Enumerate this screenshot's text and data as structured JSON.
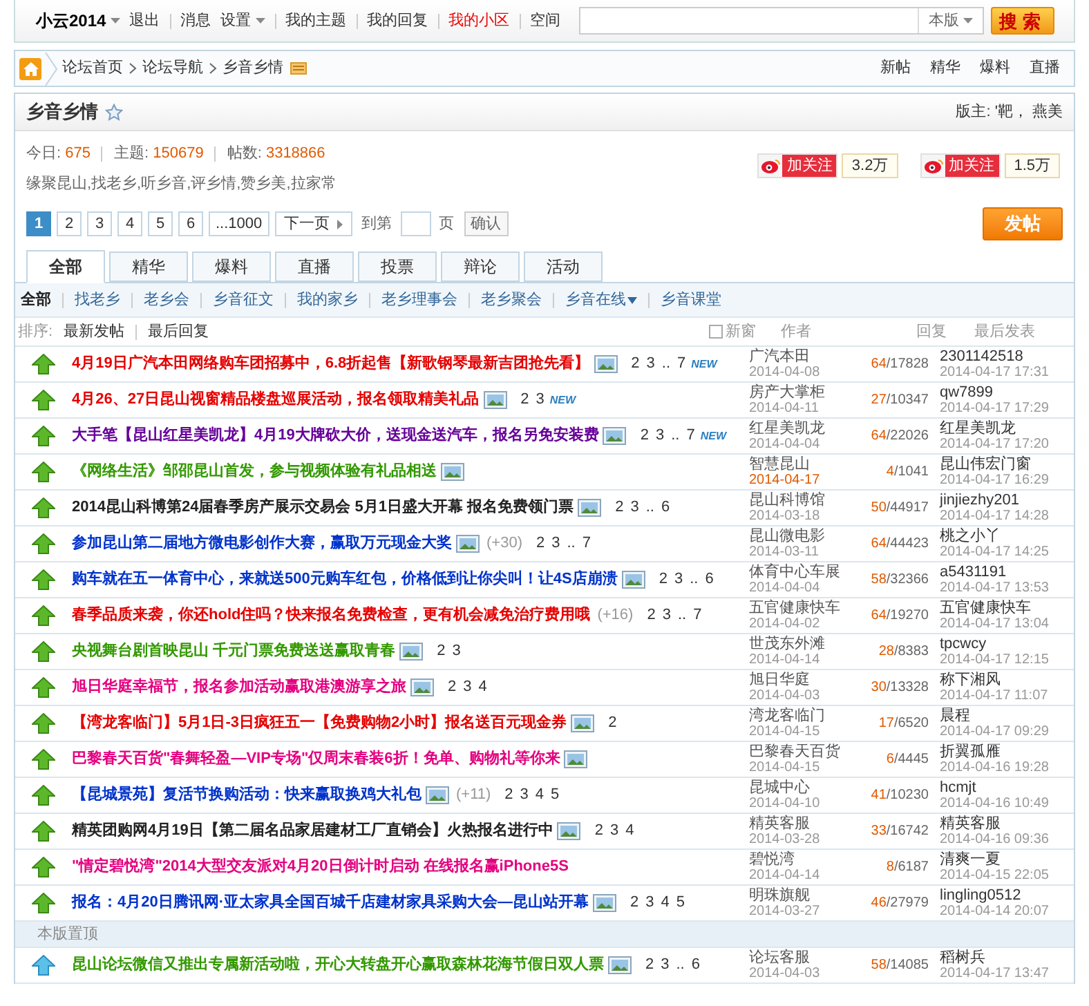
{
  "top_bar": {
    "user": "小云2014",
    "links": [
      {
        "label": "退出",
        "kind": "plain"
      },
      {
        "label": "消息",
        "kind": "plain"
      },
      {
        "label": "设置",
        "kind": "dropdown"
      },
      {
        "label": "我的主题",
        "kind": "plain"
      },
      {
        "label": "我的回复",
        "kind": "plain"
      },
      {
        "label": "我的小区",
        "kind": "highlight"
      },
      {
        "label": "空间",
        "kind": "plain"
      }
    ],
    "search": {
      "scope": "本版",
      "button": "搜索"
    }
  },
  "breadcrumb": {
    "items": [
      "论坛首页",
      "论坛导航",
      "乡音乡情"
    ],
    "quick_links": [
      "新帖",
      "精华",
      "爆料",
      "直播"
    ]
  },
  "forum": {
    "title": "乡音乡情",
    "moderators": "版主: '靶， 燕美",
    "stats": [
      {
        "label": "今日:",
        "value": "675"
      },
      {
        "label": "主题:",
        "value": "150679"
      },
      {
        "label": "帖数:",
        "value": "3318866"
      }
    ],
    "description": "缘聚昆山,找老乡,听乡音,评乡情,赞乡美,拉家常",
    "follows": [
      {
        "label": "加关注",
        "count": "3.2万"
      },
      {
        "label": "加关注",
        "count": "1.5万"
      }
    ],
    "pagination": {
      "pages": [
        {
          "label": "1",
          "selected": true
        },
        {
          "label": "2",
          "selected": false
        },
        {
          "label": "3",
          "selected": false
        },
        {
          "label": "4",
          "selected": false
        },
        {
          "label": "5",
          "selected": false
        },
        {
          "label": "6",
          "selected": false
        },
        {
          "label": "...1000",
          "selected": false
        }
      ],
      "next": "下一页",
      "goto_prefix": "到第",
      "goto_suffix": "页",
      "confirm": "确认"
    },
    "post_button": "发帖"
  },
  "tabs": [
    {
      "label": "全部",
      "selected": true
    },
    {
      "label": "精华",
      "selected": false
    },
    {
      "label": "爆料",
      "selected": false
    },
    {
      "label": "直播",
      "selected": false
    },
    {
      "label": "投票",
      "selected": false
    },
    {
      "label": "辩论",
      "selected": false
    },
    {
      "label": "活动",
      "selected": false
    }
  ],
  "filters": [
    {
      "label": "全部",
      "selected": true,
      "dropdown": false
    },
    {
      "label": "找老乡",
      "selected": false,
      "dropdown": false
    },
    {
      "label": "老乡会",
      "selected": false,
      "dropdown": false
    },
    {
      "label": "乡音征文",
      "selected": false,
      "dropdown": false
    },
    {
      "label": "我的家乡",
      "selected": false,
      "dropdown": false
    },
    {
      "label": "老乡理事会",
      "selected": false,
      "dropdown": false
    },
    {
      "label": "老乡聚会",
      "selected": false,
      "dropdown": false
    },
    {
      "label": "乡音在线",
      "selected": false,
      "dropdown": true
    },
    {
      "label": "乡音课堂",
      "selected": false,
      "dropdown": false
    }
  ],
  "table_header": {
    "sort_label": "排序:",
    "sorts": [
      "最新发帖",
      "最后回复"
    ],
    "new_window": {
      "label": "新窗",
      "checked": false
    },
    "columns": [
      "作者",
      "回复",
      "最后发表"
    ]
  },
  "threads": [
    {
      "kind": "normal",
      "title": "4月19日广汽本田网络购车团招募中，6.8折起售【新歌钢琴最新吉团抢先看】",
      "color": "#e60000",
      "has_image": true,
      "pages": [
        "2",
        "3",
        "..",
        "7"
      ],
      "badge": "NEW",
      "author": "广汽本田",
      "date": "2014-04-08",
      "date_new": false,
      "replies": "64",
      "views": "/17828",
      "last_user": "2301142518",
      "last_time": "2014-04-17 17:31"
    },
    {
      "kind": "normal",
      "title": "4月26、27日昆山视窗精品楼盘巡展活动，报名领取精美礼品",
      "color": "#e60000",
      "has_image": true,
      "pages": [
        "2",
        "3"
      ],
      "badge": "NEW",
      "author": "房产大掌柜",
      "date": "2014-04-11",
      "date_new": false,
      "replies": "27",
      "views": "/10347",
      "last_user": "qw7899",
      "last_time": "2014-04-17 17:29"
    },
    {
      "kind": "normal",
      "title": "大手笔【昆山红星美凯龙】4月19大牌砍大价，送现金送汽车，报名另免安装费",
      "color": "#660099",
      "has_image": true,
      "pages": [
        "2",
        "3",
        "..",
        "7"
      ],
      "badge": "NEW",
      "author": "红星美凯龙",
      "date": "2014-04-04",
      "date_new": false,
      "replies": "64",
      "views": "/22026",
      "last_user": "红星美凯龙",
      "last_time": "2014-04-17 17:20"
    },
    {
      "kind": "normal",
      "title": "《网络生活》邹邵昆山首发，参与视频体验有礼品相送",
      "color": "#339900",
      "has_image": true,
      "author": "智慧昆山",
      "date": "2014-04-17",
      "date_new": true,
      "replies": "4",
      "views": "/1041",
      "last_user": "昆山伟宏门窗",
      "last_time": "2014-04-17 16:29"
    },
    {
      "kind": "normal",
      "title": "2014昆山科博第24届春季房产展示交易会 5月1日盛大开幕 报名免费领门票",
      "color": "#222222",
      "has_image": true,
      "pages": [
        "2",
        "3",
        "..",
        "6"
      ],
      "author": "昆山科博馆",
      "date": "2014-03-18",
      "date_new": false,
      "replies": "50",
      "views": "/44917",
      "last_user": "jinjiezhy201",
      "last_time": "2014-04-17 14:28"
    },
    {
      "kind": "normal",
      "title": "参加昆山第二届地方微电影创作大赛，赢取万元现金大奖",
      "color": "#0033cc",
      "has_image": true,
      "extra": "(+30)",
      "pages": [
        "2",
        "3",
        "..",
        "7"
      ],
      "author": "昆山微电影",
      "date": "2014-03-11",
      "date_new": false,
      "replies": "64",
      "views": "/44423",
      "last_user": "桃之小丫",
      "last_time": "2014-04-17 14:25"
    },
    {
      "kind": "normal",
      "title": "购车就在五一体育中心，来就送500元购车红包，价格低到让你尖叫！让4S店崩溃",
      "color": "#0033cc",
      "has_image": true,
      "pages": [
        "2",
        "3",
        "..",
        "6"
      ],
      "author": "体育中心车展",
      "date": "2014-04-04",
      "date_new": false,
      "replies": "58",
      "views": "/32366",
      "last_user": "a5431191",
      "last_time": "2014-04-17 13:53"
    },
    {
      "kind": "normal",
      "title": "春季品质来袭，你还hold住吗？快来报名免费检查，更有机会减免治疗费用哦",
      "color": "#e60000",
      "has_image": false,
      "extra": "(+16)",
      "pages": [
        "2",
        "3",
        "..",
        "7"
      ],
      "author": "五官健康快车",
      "date": "2014-04-02",
      "date_new": false,
      "replies": "64",
      "views": "/19270",
      "last_user": "五官健康快车",
      "last_time": "2014-04-17 13:04"
    },
    {
      "kind": "normal",
      "title": "央视舞台剧首映昆山 千元门票免费送送赢取青春",
      "color": "#339900",
      "has_image": true,
      "pages": [
        "2",
        "3"
      ],
      "author": "世茂东外滩",
      "date": "2014-04-14",
      "date_new": false,
      "replies": "28",
      "views": "/8383",
      "last_user": "tpcwcy",
      "last_time": "2014-04-17 12:15"
    },
    {
      "kind": "normal",
      "title": "旭日华庭幸福节，报名参加活动赢取港澳游享之旅",
      "color": "#e4007f",
      "has_image": true,
      "pages": [
        "2",
        "3",
        "4"
      ],
      "author": "旭日华庭",
      "date": "2014-04-03",
      "date_new": false,
      "replies": "30",
      "views": "/13328",
      "last_user": "称下湘风",
      "last_time": "2014-04-17 11:07"
    },
    {
      "kind": "normal",
      "title": "【湾龙客临门】5月1日-3日疯狂五一【免费购物2小时】报名送百元现金券",
      "color": "#e60000",
      "has_image": true,
      "pages": [
        "2"
      ],
      "author": "湾龙客临门",
      "date": "2014-04-15",
      "date_new": false,
      "replies": "17",
      "views": "/6520",
      "last_user": "晨程",
      "last_time": "2014-04-17 09:29"
    },
    {
      "kind": "normal",
      "title": "巴黎春天百货\"春舞轻盈—VIP专场\"仅周末春装6折！免单、购物礼等你来",
      "color": "#e4007f",
      "has_image": true,
      "author": "巴黎春天百货",
      "date": "2014-04-15",
      "date_new": false,
      "replies": "6",
      "views": "/4445",
      "last_user": "折翼孤雁",
      "last_time": "2014-04-16 19:28"
    },
    {
      "kind": "normal",
      "title": "【昆城景苑】复活节换购活动：快来赢取换鸡大礼包",
      "color": "#0033cc",
      "has_image": true,
      "extra": "(+11)",
      "pages": [
        "2",
        "3",
        "4",
        "5"
      ],
      "author": "昆城中心",
      "date": "2014-04-10",
      "date_new": false,
      "replies": "41",
      "views": "/10230",
      "last_user": "hcmjt",
      "last_time": "2014-04-16 10:49"
    },
    {
      "kind": "normal",
      "title": "精英团购网4月19日【第二届名品家居建材工厂直销会】火热报名进行中",
      "color": "#222222",
      "has_image": true,
      "pages": [
        "2",
        "3",
        "4"
      ],
      "author": "精英客服",
      "date": "2014-03-28",
      "date_new": false,
      "replies": "33",
      "views": "/16742",
      "last_user": "精英客服",
      "last_time": "2014-04-16 09:36"
    },
    {
      "kind": "normal",
      "title": "\"情定碧悦湾\"2014大型交友派对4月20日倒计时启动 在线报名赢iPhone5S",
      "color": "#e4007f",
      "has_image": false,
      "author": "碧悦湾",
      "date": "2014-04-14",
      "date_new": false,
      "replies": "8",
      "views": "/6187",
      "last_user": "清爽一夏",
      "last_time": "2014-04-15 22:05"
    },
    {
      "kind": "normal",
      "title": "报名：4月20日腾讯网·亚太家具全国百城千店建材家具采购大会—昆山站开幕",
      "color": "#0033cc",
      "has_image": true,
      "pages": [
        "2",
        "3",
        "4",
        "5"
      ],
      "author": "明珠旗舰",
      "date": "2014-03-27",
      "date_new": false,
      "replies": "46",
      "views": "/27979",
      "last_user": "lingling0512",
      "last_time": "2014-04-14 20:07"
    },
    {
      "kind": "section",
      "title": "本版置顶"
    },
    {
      "kind": "sticky",
      "title": "昆山论坛微信又推出专属新活动啦，开心大转盘开心赢取森林花海节假日双人票",
      "color": "#339900",
      "has_image": true,
      "pages": [
        "2",
        "3",
        "..",
        "6"
      ],
      "author": "论坛客服",
      "date": "2014-04-03",
      "date_new": false,
      "replies": "58",
      "views": "/14085",
      "last_user": "稻树兵",
      "last_time": "2014-04-17 13:47"
    }
  ]
}
